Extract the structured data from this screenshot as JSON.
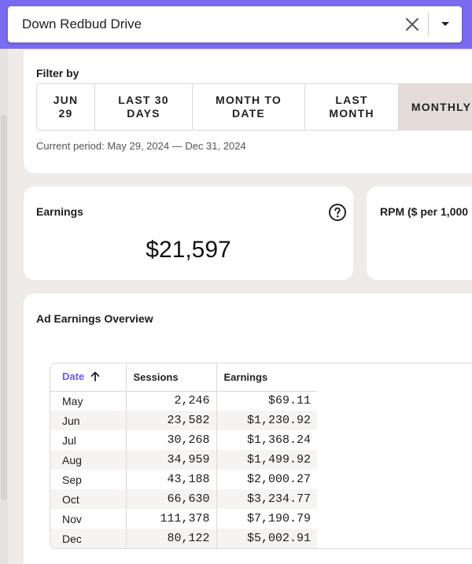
{
  "site_select": {
    "value": "Down Redbud Drive",
    "clear_icon": "close-icon",
    "dropdown_icon": "caret-down-icon"
  },
  "filter": {
    "title": "Filter by",
    "buttons": [
      {
        "label": "JUN\n29",
        "active": false
      },
      {
        "label": "LAST 30\nDAYS",
        "active": false
      },
      {
        "label": "MONTH TO\nDATE",
        "active": false
      },
      {
        "label": "LAST\nMONTH",
        "active": false
      },
      {
        "label": "MONTHLY",
        "active": true
      }
    ],
    "current_period": "Current period: May 29, 2024 — Dec 31, 2024"
  },
  "earnings_card": {
    "label": "Earnings",
    "value": "$21,597",
    "help_icon": "question-circle-icon"
  },
  "rpm_card": {
    "label": "RPM ($ per 1,000"
  },
  "overview": {
    "title": "Ad Earnings Overview",
    "columns": {
      "date": "Date",
      "sessions": "Sessions",
      "earnings": "Earnings"
    },
    "sort_icon": "arrow-up-icon",
    "rows": [
      {
        "date": "May",
        "sessions": "2,246",
        "earnings": "$69.11"
      },
      {
        "date": "Jun",
        "sessions": "23,582",
        "earnings": "$1,230.92"
      },
      {
        "date": "Jul",
        "sessions": "30,268",
        "earnings": "$1,368.24"
      },
      {
        "date": "Aug",
        "sessions": "34,959",
        "earnings": "$1,499.92"
      },
      {
        "date": "Sep",
        "sessions": "43,188",
        "earnings": "$2,000.27"
      },
      {
        "date": "Oct",
        "sessions": "66,630",
        "earnings": "$3,234.77"
      },
      {
        "date": "Nov",
        "sessions": "111,378",
        "earnings": "$7,190.79"
      },
      {
        "date": "Dec",
        "sessions": "80,122",
        "earnings": "$5,002.91"
      }
    ]
  },
  "colors": {
    "accent": "#7a6cf0",
    "sort_header": "#6b5ce7",
    "page_bg": "#efebe8",
    "active_filter_bg": "#e3dcd8"
  }
}
